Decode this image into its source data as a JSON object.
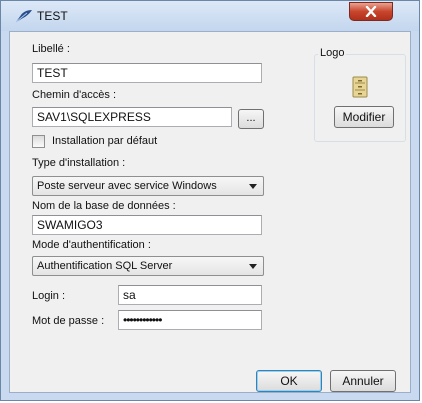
{
  "window": {
    "title": "TEST",
    "close_label": "x"
  },
  "form": {
    "libelle_label": "Libellé :",
    "libelle_value": "TEST",
    "chemin_label": "Chemin d'accès :",
    "chemin_value": "SAV1\\SQLEXPRESS",
    "browse_label": "...",
    "installation_defaut_label": "Installation par défaut",
    "installation_defaut_checked": false,
    "type_installation_label": "Type d'installation :",
    "type_installation_value": "Poste serveur avec service Windows",
    "nom_base_label": "Nom de la base de données :",
    "nom_base_value": "SWAMIGO3",
    "mode_auth_label": "Mode d'authentification :",
    "mode_auth_value": "Authentification SQL Server",
    "login_label": "Login :",
    "login_value": "sa",
    "password_label": "Mot de passe :",
    "password_value": "••••••••••••"
  },
  "logo": {
    "label": "Logo",
    "icon": "file-cabinet-icon",
    "modifier_label": "Modifier"
  },
  "footer": {
    "ok_label": "OK",
    "cancel_label": "Annuler"
  },
  "colors": {
    "titlebar": "#c3d6ee",
    "client": "#f0f0f0",
    "close": "#c9452c"
  }
}
